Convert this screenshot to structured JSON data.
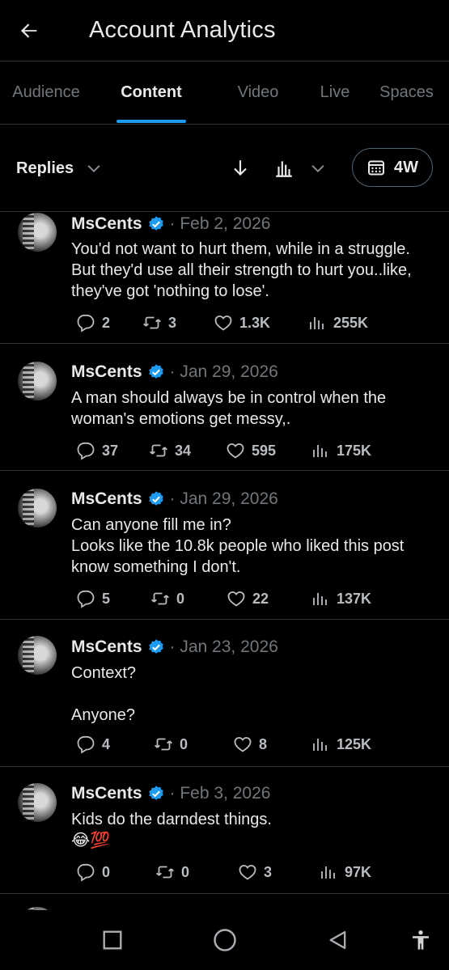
{
  "header": {
    "title": "Account Analytics"
  },
  "tabs": [
    {
      "label": "Audience"
    },
    {
      "label": "Content"
    },
    {
      "label": "Video"
    },
    {
      "label": "Live"
    },
    {
      "label": "Spaces"
    }
  ],
  "filter": {
    "selected": "Replies",
    "range": "4W"
  },
  "posts": [
    {
      "name": "MsCents",
      "date": "· Feb 2, 2026",
      "text": "You'd not want to hurt them, while in a struggle. But they'd use all their strength to hurt you..like, they've got 'nothing to lose'.",
      "replies": "2",
      "reposts": "3",
      "likes": "1.3K",
      "views": "255K"
    },
    {
      "name": "MsCents",
      "date": "· Jan 29, 2026",
      "text": "A man should always be in control when the woman's emotions get messy,.",
      "replies": "37",
      "reposts": "34",
      "likes": "595",
      "views": "175K"
    },
    {
      "name": "MsCents",
      "date": "· Jan 29, 2026",
      "text": "Can anyone fill me in?\nLooks like the 10.8k people who liked this post know something I don't.",
      "replies": "5",
      "reposts": "0",
      "likes": "22",
      "views": "137K"
    },
    {
      "name": "MsCents",
      "date": "· Jan 23, 2026",
      "text": "Context?\n\nAnyone?",
      "replies": "4",
      "reposts": "0",
      "likes": "8",
      "views": "125K"
    },
    {
      "name": "MsCents",
      "date": "· Feb 3, 2026",
      "text": "Kids do the darndest things.\n😂💯",
      "replies": "0",
      "reposts": "0",
      "likes": "3",
      "views": "97K"
    }
  ],
  "colors": {
    "accent": "#1d9bf0",
    "background": "#000000",
    "text": "#e7e9ea",
    "muted": "#71767b",
    "divider": "#2f3336"
  },
  "icons": {
    "back": "arrow-left-icon",
    "sort": "arrow-down-icon",
    "metric": "bar-chart-icon",
    "calendar": "calendar-icon",
    "verified": "verified-badge-icon",
    "reply": "reply-icon",
    "repost": "repost-icon",
    "like": "heart-icon",
    "views": "views-icon",
    "nav_recents": "square-icon",
    "nav_home": "circle-icon",
    "nav_back": "triangle-back-icon",
    "nav_accessibility": "accessibility-icon"
  }
}
